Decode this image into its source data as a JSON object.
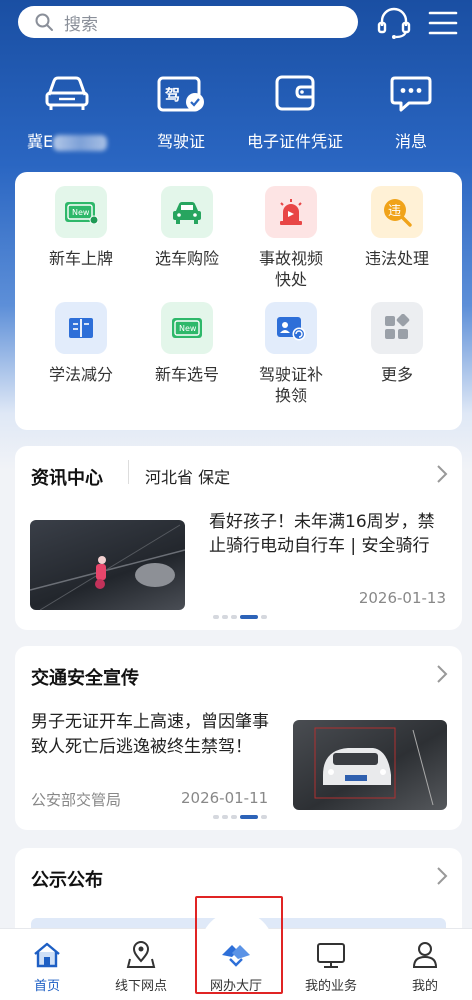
{
  "header": {
    "search_placeholder": "搜索",
    "icons": [
      "headset-icon",
      "menu-icon"
    ]
  },
  "quick": [
    {
      "label_prefix": "冀E",
      "icon": "car-icon",
      "label_redacted": true
    },
    {
      "label": "驾驶证",
      "icon": "driver-license-icon"
    },
    {
      "label": "电子证件凭证",
      "icon": "wallet-icon"
    },
    {
      "label": "消息",
      "icon": "message-icon"
    }
  ],
  "services": [
    {
      "label": "新车上牌",
      "icon": "new-plate-icon",
      "color": "#2eb86a"
    },
    {
      "label": "选车购险",
      "icon": "car-insurance-icon",
      "color": "#27a55f"
    },
    {
      "label": "事故视频快处",
      "line1": "事故视频",
      "line2": "快处",
      "icon": "siren-icon",
      "color": "#e84646"
    },
    {
      "label": "违法处理",
      "icon": "violation-icon",
      "color": "#f0a31a"
    },
    {
      "label": "学法减分",
      "icon": "book-icon",
      "color": "#2e6fd8"
    },
    {
      "label": "新车选号",
      "icon": "new-number-icon",
      "color": "#2eb86a"
    },
    {
      "label": "驾驶证补换领",
      "line1": "驾驶证补",
      "line2": "换领",
      "icon": "license-renew-icon",
      "color": "#2e6fd8"
    },
    {
      "label": "更多",
      "icon": "more-grid-icon",
      "color": "#9aa0a8"
    }
  ],
  "news": {
    "title": "资讯中心",
    "region": "河北省 保定",
    "headline": "看好孩子！未年满16周岁，禁止骑行电动自行车 | 安全骑行",
    "date": "2026-01-13"
  },
  "safety": {
    "title": "交通安全宣传",
    "headline": "男子无证开车上高速，曾因肇事致人死亡后逃逸被终生禁驾！",
    "source": "公安部交管局",
    "date": "2026-01-11"
  },
  "notice": {
    "title": "公示公布"
  },
  "tabbar": [
    {
      "label": "首页",
      "icon": "home-icon",
      "active": true
    },
    {
      "label": "线下网点",
      "icon": "map-pin-icon",
      "active": false
    },
    {
      "label": "网办大厅",
      "icon": "handshake-icon",
      "active": false
    },
    {
      "label": "我的业务",
      "icon": "monitor-icon",
      "active": false
    },
    {
      "label": "我的",
      "icon": "user-icon",
      "active": false
    }
  ],
  "colors": {
    "brand_blue": "#1a4fa3",
    "active_tab": "#1e5fc4",
    "highlight_red": "#e02424"
  }
}
